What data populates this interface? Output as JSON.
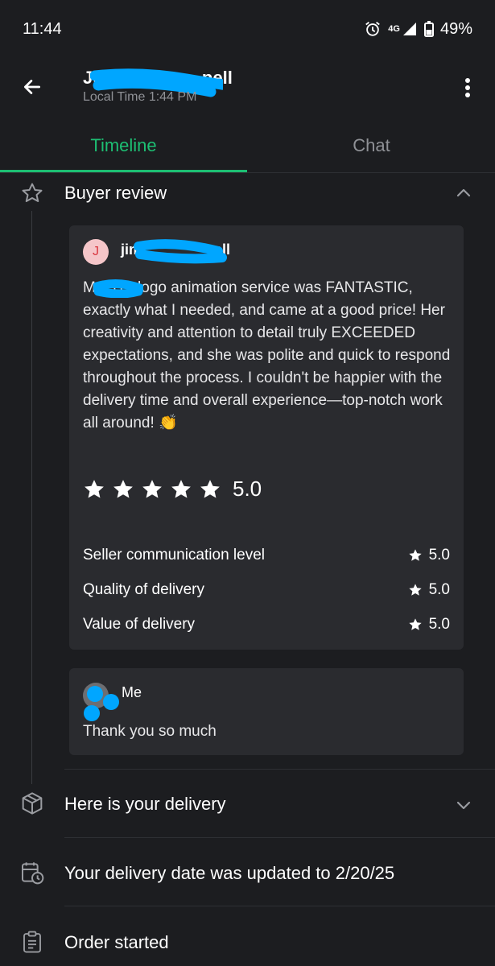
{
  "status_bar": {
    "time": "11:44",
    "network": "4G",
    "battery": "49%"
  },
  "header": {
    "name": "Jim",
    "name_tail": "pell",
    "subtitle": "Local Time 1:44 PM"
  },
  "tabs": [
    {
      "label": "Timeline",
      "active": true
    },
    {
      "label": "Chat",
      "active": false
    }
  ],
  "buyer_review": {
    "title": "Buyer review",
    "reviewer_initial": "J",
    "reviewer_name": "jim",
    "reviewer_name_tail": "ell",
    "text": "M a B's logo animation service was FANTASTIC, exactly what I needed, and came at a good price! Her creativity and attention to detail truly EXCEEDED expectations, and she was polite and quick to respond throughout the process. I couldn't be happier with the delivery time and overall experience—top-notch work all around! 👏",
    "overall_rating": "5.0",
    "star_count": 5,
    "metrics": [
      {
        "label": "Seller communication level",
        "score": "5.0"
      },
      {
        "label": "Quality of delivery",
        "score": "5.0"
      },
      {
        "label": "Value of delivery",
        "score": "5.0"
      }
    ]
  },
  "reply": {
    "author": "Me",
    "text": "Thank you so much"
  },
  "timeline_items": [
    {
      "title": "Here is your delivery",
      "icon": "package-icon"
    },
    {
      "title": "Your delivery date was updated to 2/20/25",
      "icon": "calendar-clock-icon"
    },
    {
      "title": "Order started",
      "icon": "clipboard-icon"
    }
  ],
  "colors": {
    "accent": "#1dbf73",
    "background": "#1c1d20",
    "card": "#2a2b2f",
    "redaction": "#00a6ff"
  }
}
